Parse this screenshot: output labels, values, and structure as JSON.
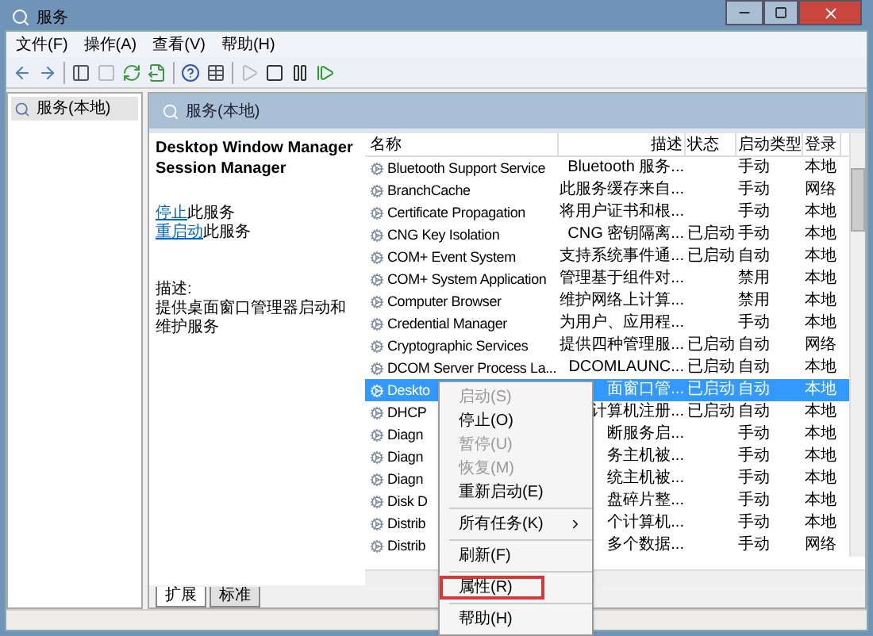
{
  "window": {
    "title": "服务"
  },
  "menu": [
    {
      "label": "文件(F)"
    },
    {
      "label": "操作(A)"
    },
    {
      "label": "查看(V)"
    },
    {
      "label": "帮助(H)"
    }
  ],
  "toolbar": [
    {
      "kind": "back",
      "disabled": false
    },
    {
      "kind": "forward",
      "disabled": false
    },
    {
      "kind": "sep"
    },
    {
      "kind": "panel",
      "disabled": false
    },
    {
      "kind": "page",
      "disabled": true
    },
    {
      "kind": "refresh",
      "disabled": false
    },
    {
      "kind": "export",
      "disabled": false
    },
    {
      "kind": "sep"
    },
    {
      "kind": "help",
      "disabled": false
    },
    {
      "kind": "grid",
      "disabled": false
    },
    {
      "kind": "sep"
    },
    {
      "kind": "play",
      "disabled": true
    },
    {
      "kind": "stop",
      "disabled": false
    },
    {
      "kind": "pause",
      "disabled": false
    },
    {
      "kind": "resume",
      "disabled": false
    }
  ],
  "tree": [
    {
      "label": "服务(本地)",
      "selected": true
    }
  ],
  "pane_header": "服务(本地)",
  "detail": {
    "title": "Desktop Window Manager Session Manager",
    "actions": [
      {
        "link": "停止",
        "rest": "此服务"
      },
      {
        "link": "重启动",
        "rest": "此服务"
      }
    ],
    "description_label": "描述:",
    "description": "提供桌面窗口管理器启动和维护服务"
  },
  "table": {
    "columns": [
      "名称",
      "描述",
      "状态",
      "启动类型",
      "登录"
    ],
    "rows": [
      {
        "cells": [
          "Bluetooth Support Service",
          "Bluetooth 服务...",
          "",
          "手动",
          "本地"
        ],
        "selected": false
      },
      {
        "cells": [
          "BranchCache",
          "此服务缓存来自...",
          "",
          "手动",
          "网络"
        ],
        "selected": false
      },
      {
        "cells": [
          "Certificate Propagation",
          "将用户证书和根...",
          "",
          "手动",
          "本地"
        ],
        "selected": false
      },
      {
        "cells": [
          "CNG Key Isolation",
          "CNG 密钥隔离...",
          "已启动",
          "手动",
          "本地"
        ],
        "selected": false
      },
      {
        "cells": [
          "COM+ Event System",
          "支持系统事件通...",
          "已启动",
          "自动",
          "本地"
        ],
        "selected": false
      },
      {
        "cells": [
          "COM+ System Application",
          "管理基于组件对...",
          "",
          "禁用",
          "本地"
        ],
        "selected": false
      },
      {
        "cells": [
          "Computer Browser",
          "维护网络上计算...",
          "",
          "禁用",
          "本地"
        ],
        "selected": false
      },
      {
        "cells": [
          "Credential Manager",
          "为用户、应用程...",
          "",
          "手动",
          "本地"
        ],
        "selected": false
      },
      {
        "cells": [
          "Cryptographic Services",
          "提供四种管理服...",
          "已启动",
          "自动",
          "网络"
        ],
        "selected": false
      },
      {
        "cells": [
          "DCOM Server Process La...",
          "DCOMLAUNC...",
          "已启动",
          "自动",
          "本地"
        ],
        "selected": false
      },
      {
        "cells": [
          "Deskto",
          "面窗口管...",
          "已启动",
          "自动",
          "本地"
        ],
        "selected": true
      },
      {
        "cells": [
          "DHCP",
          "计算机注册...",
          "已启动",
          "自动",
          "本地"
        ],
        "selected": false
      },
      {
        "cells": [
          "Diagn",
          "断服务启...",
          "",
          "手动",
          "本地"
        ],
        "selected": false
      },
      {
        "cells": [
          "Diagn",
          "务主机被...",
          "",
          "手动",
          "本地"
        ],
        "selected": false
      },
      {
        "cells": [
          "Diagn",
          "统主机被...",
          "",
          "手动",
          "本地"
        ],
        "selected": false
      },
      {
        "cells": [
          "Disk D",
          "盘碎片整...",
          "",
          "手动",
          "本地"
        ],
        "selected": false
      },
      {
        "cells": [
          "Distrib",
          "个计算机...",
          "",
          "手动",
          "本地"
        ],
        "selected": false
      },
      {
        "cells": [
          "Distrib",
          "多个数据...",
          "",
          "手动",
          "网络"
        ],
        "selected": false
      }
    ]
  },
  "bottom_tabs": [
    {
      "label": "扩展",
      "selected": true
    },
    {
      "label": "标准",
      "selected": false
    }
  ],
  "context_menu": [
    {
      "kind": "item",
      "label": "启动(S)",
      "disabled": true,
      "boxed": false
    },
    {
      "kind": "item",
      "label": "停止(O)",
      "disabled": false,
      "boxed": false
    },
    {
      "kind": "item",
      "label": "暂停(U)",
      "disabled": true,
      "boxed": false
    },
    {
      "kind": "item",
      "label": "恢复(M)",
      "disabled": true,
      "boxed": false
    },
    {
      "kind": "item",
      "label": "重新启动(E)",
      "disabled": false,
      "boxed": false
    },
    {
      "kind": "sep"
    },
    {
      "kind": "submenu",
      "label": "所有任务(K)",
      "disabled": false,
      "boxed": false
    },
    {
      "kind": "sep"
    },
    {
      "kind": "item",
      "label": "刷新(F)",
      "disabled": false,
      "boxed": false
    },
    {
      "kind": "sep"
    },
    {
      "kind": "item",
      "label": "属性(R)",
      "disabled": false,
      "boxed": true
    },
    {
      "kind": "sep"
    },
    {
      "kind": "item",
      "label": "帮助(H)",
      "disabled": false,
      "boxed": false
    }
  ]
}
